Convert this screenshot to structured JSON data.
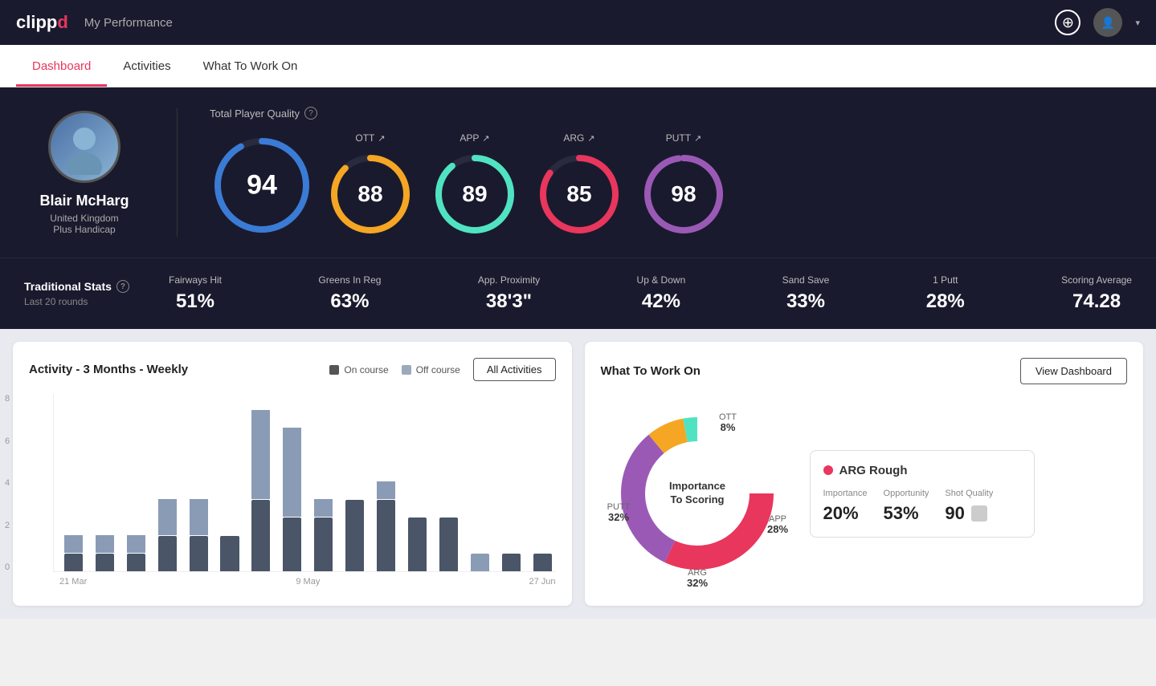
{
  "header": {
    "logo": "clippd",
    "logo_clip": "clipp",
    "logo_d": "d",
    "title": "My Performance"
  },
  "nav": {
    "tabs": [
      {
        "id": "dashboard",
        "label": "Dashboard",
        "active": true
      },
      {
        "id": "activities",
        "label": "Activities",
        "active": false
      },
      {
        "id": "what-to-work-on",
        "label": "What To Work On",
        "active": false
      }
    ]
  },
  "player": {
    "name": "Blair McHarg",
    "country": "United Kingdom",
    "handicap": "Plus Handicap"
  },
  "quality": {
    "label": "Total Player Quality",
    "main": {
      "value": "94",
      "color": "#3a7bd5"
    },
    "ott": {
      "label": "OTT",
      "value": "88",
      "color": "#f5a623"
    },
    "app": {
      "label": "APP",
      "value": "89",
      "color": "#50e3c2"
    },
    "arg": {
      "label": "ARG",
      "value": "85",
      "color": "#e8365d"
    },
    "putt": {
      "label": "PUTT",
      "value": "98",
      "color": "#9b59b6"
    }
  },
  "trad_stats": {
    "title": "Traditional Stats",
    "subtitle": "Last 20 rounds",
    "items": [
      {
        "label": "Fairways Hit",
        "value": "51%"
      },
      {
        "label": "Greens In Reg",
        "value": "63%"
      },
      {
        "label": "App. Proximity",
        "value": "38'3\""
      },
      {
        "label": "Up & Down",
        "value": "42%"
      },
      {
        "label": "Sand Save",
        "value": "33%"
      },
      {
        "label": "1 Putt",
        "value": "28%"
      },
      {
        "label": "Scoring Average",
        "value": "74.28"
      }
    ]
  },
  "activity_chart": {
    "title": "Activity - 3 Months - Weekly",
    "legend": {
      "on_course": "On course",
      "off_course": "Off course"
    },
    "all_activities_btn": "All Activities",
    "x_labels": [
      "21 Mar",
      "9 May",
      "27 Jun"
    ],
    "y_labels": [
      "8",
      "6",
      "4",
      "2",
      "0"
    ],
    "bars": [
      {
        "on": 1,
        "off": 1
      },
      {
        "on": 1,
        "off": 1
      },
      {
        "on": 1,
        "off": 1
      },
      {
        "on": 2,
        "off": 2
      },
      {
        "on": 2,
        "off": 2
      },
      {
        "on": 2,
        "off": 0
      },
      {
        "on": 4,
        "off": 5
      },
      {
        "on": 3,
        "off": 5
      },
      {
        "on": 3,
        "off": 1
      },
      {
        "on": 4,
        "off": 0
      },
      {
        "on": 4,
        "off": 1
      },
      {
        "on": 3,
        "off": 0
      },
      {
        "on": 3,
        "off": 0
      },
      {
        "on": 0,
        "off": 1
      },
      {
        "on": 1,
        "off": 0
      },
      {
        "on": 1,
        "off": 0
      }
    ]
  },
  "what_to_work_on": {
    "title": "What To Work On",
    "view_dashboard_btn": "View Dashboard",
    "donut_center": "Importance\nTo Scoring",
    "segments": [
      {
        "label": "OTT",
        "value": "8%",
        "color": "#f5a623"
      },
      {
        "label": "APP",
        "value": "28%",
        "color": "#50e3c2"
      },
      {
        "label": "ARG",
        "value": "32%",
        "color": "#e8365d"
      },
      {
        "label": "PUTT",
        "value": "32%",
        "color": "#9b59b6"
      }
    ],
    "detail": {
      "title": "ARG Rough",
      "dot_color": "#e8365d",
      "metrics": [
        {
          "label": "Importance",
          "value": "20%"
        },
        {
          "label": "Opportunity",
          "value": "53%"
        },
        {
          "label": "Shot Quality",
          "value": "90"
        }
      ]
    }
  }
}
